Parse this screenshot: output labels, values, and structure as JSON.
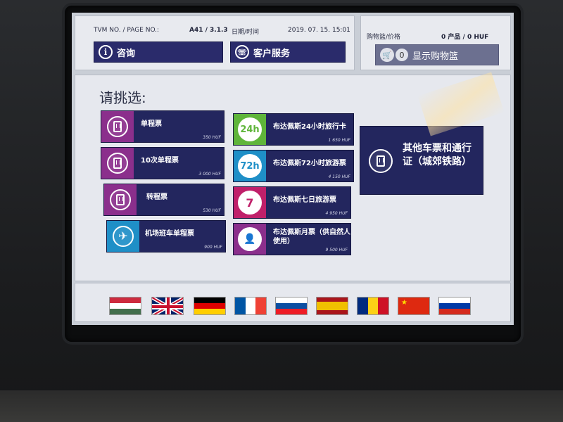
{
  "header": {
    "tvm_label": "TVM NO. / PAGE NO.:",
    "tvm_value": "A41 / 3.1.3",
    "datetime_label": "日期/时间",
    "datetime_value": "2019. 07. 15. 15:01",
    "info_button": "咨询",
    "service_button": "客户服务",
    "cart_label": "购物篮/价格",
    "cart_value": "0 产品 / 0 HUF",
    "cart_count": "0",
    "cart_button": "显示购物篮"
  },
  "prompt": "请挑选:",
  "tickets_left": [
    {
      "name": "单程票",
      "price": "350 HUF",
      "color": "#8b2f8c"
    },
    {
      "name": "10次单程票",
      "price": "3 000 HUF",
      "color": "#8b2f8c"
    },
    {
      "name": "转程票",
      "price": "530 HUF",
      "color": "#8b2f8c"
    },
    {
      "name": "机场班车单程票",
      "price": "900 HUF",
      "color": "#1f8fc7"
    }
  ],
  "tickets_mid": [
    {
      "badge": "24h",
      "name": "布达佩斯24小时旅行卡",
      "price": "1 650 HUF",
      "color": "#5fb53a"
    },
    {
      "badge": "72h",
      "name": "布达佩斯72小时旅游票",
      "price": "4 150 HUF",
      "color": "#1f8fc7"
    },
    {
      "badge": "7",
      "name": "布达佩斯七日旅游票",
      "price": "4 950 HUF",
      "color": "#c0206a"
    },
    {
      "badge": "",
      "name": "布达佩斯月票（供自然人使用）",
      "price": "9 500 HUF",
      "color": "#8b2f8c"
    }
  ],
  "other": {
    "name": "其他车票和通行证（城郊铁路）"
  },
  "colors": {
    "tile_bg": "#23265e",
    "header_btn": "#2a2b6b",
    "cart_btn": "#6c7090"
  }
}
